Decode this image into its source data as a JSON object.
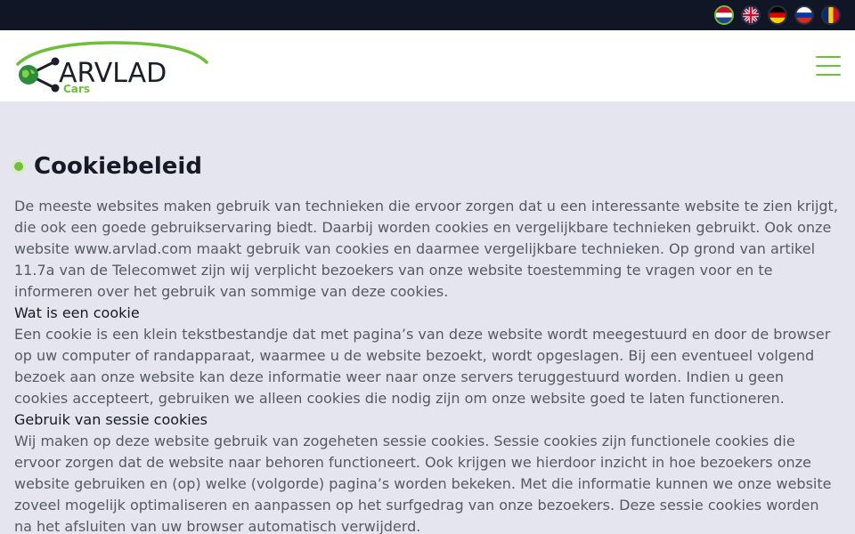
{
  "languages": [
    {
      "name": "nl-flag-icon",
      "active": true
    },
    {
      "name": "gb-flag-icon",
      "active": false
    },
    {
      "name": "de-flag-icon",
      "active": false
    },
    {
      "name": "ru-flag-icon",
      "active": false
    },
    {
      "name": "ro-flag-icon",
      "active": false
    }
  ],
  "brand": {
    "name": "ARVLAD",
    "sub": "Cars"
  },
  "page": {
    "title": "Cookiebeleid",
    "intro": "De meeste websites maken gebruik van technieken die ervoor zorgen dat u een interessante website te zien krijgt, die ook een goede gebruikservaring biedt. Daarbij worden cookies en vergelijkbare technieken gebruikt. Ook onze website www.arvlad.com maakt gebruik van cookies en daarmee vergelijkbare technieken. Op grond van artikel 11.7a van de Telecomwet zijn wij verplicht bezoekers van onze website toestemming te vragen voor en te informeren over het gebruik van sommige van deze cookies.",
    "s1_heading": "Wat is een cookie",
    "s1_text": "Een cookie is een klein tekstbestandje dat met pagina’s van deze website wordt meegestuurd en door de browser op uw computer of randapparaat, waarmee u de website bezoekt, wordt opgeslagen. Bij een eventueel volgend bezoek aan onze website kan deze informatie weer naar onze servers teruggestuurd worden. Indien u geen cookies accepteert, gebruiken we alleen cookies die nodig zijn om onze website goed te laten functioneren.",
    "s2_heading": "Gebruik van sessie cookies",
    "s2_text": "Wij maken op deze website gebruik van zogeheten sessie cookies. Sessie cookies zijn functionele cookies die ervoor zorgen dat de website naar behoren functioneert. Ook krijgen we hierdoor inzicht in hoe bezoekers onze website gebruiken en (op) welke (volgorde) pagina’s worden bekeken. Met die informatie kunnen we onze website zoveel mogelijk optimaliseren en aanpassen op het surfgedrag van onze bezoekers. Deze sessie cookies worden na het afsluiten van uw browser automatisch verwijderd."
  },
  "colors": {
    "accent": "#6fbf3a",
    "topbar": "#111626",
    "background": "#e4e5ee"
  }
}
